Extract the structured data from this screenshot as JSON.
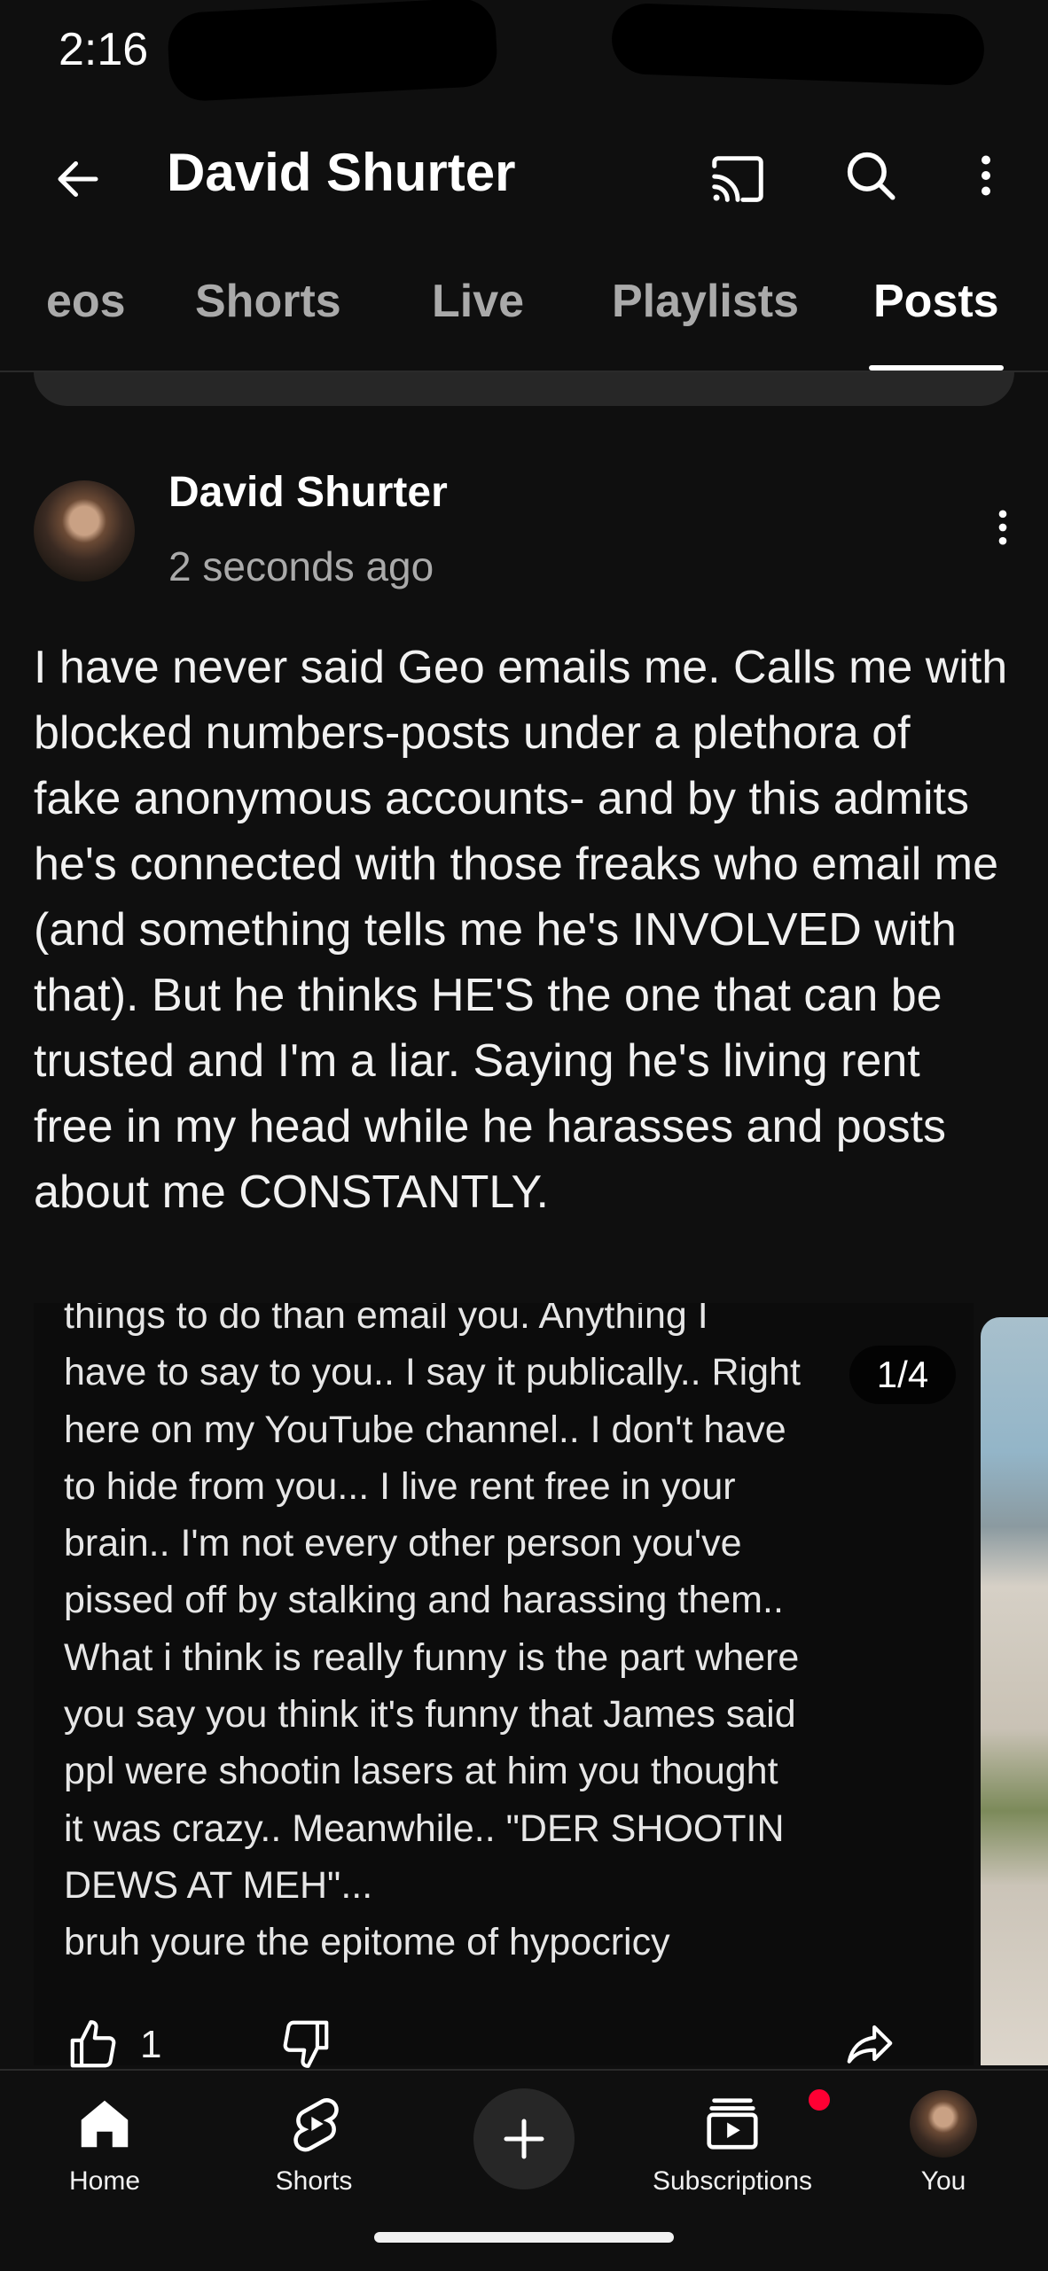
{
  "status_bar": {
    "time": "2:16"
  },
  "app_bar": {
    "title": "David Shurter"
  },
  "icons": {
    "back": "arrow-left-icon",
    "cast": "cast-icon",
    "search": "search-icon",
    "more": "more-vert-icon",
    "like": "thumbs-up-icon",
    "dislike": "thumbs-down-icon",
    "share": "share-icon",
    "home": "home-icon",
    "shorts": "shorts-icon",
    "create": "plus-icon",
    "subscriptions": "subscriptions-icon"
  },
  "tabs": [
    {
      "label": "eos",
      "active": false
    },
    {
      "label": "Shorts",
      "active": false
    },
    {
      "label": "Live",
      "active": false
    },
    {
      "label": "Playlists",
      "active": false
    },
    {
      "label": "Posts",
      "active": true
    }
  ],
  "post": {
    "author": "David Shurter",
    "time": "2 seconds ago",
    "text": "I have never said Geo emails me. Calls me with blocked numbers-posts under a plethora of fake anonymous accounts- and by this admits he's connected with those freaks who email me (and something tells me he's INVOLVED with that). But he thinks HE'S the one that can be trusted and I'm a liar. Saying he's living rent free in my head while he harasses and posts about me CONSTANTLY.",
    "image_counter": "1/4",
    "image_text_lines": [
      "things to do than email you. Anything I",
      "have to say to you.. I say it publically.. Right",
      "here on my YouTube channel.. I don't have",
      "to hide from you... I live rent free in your",
      "brain.. I'm not every other person you've",
      "pissed off by stalking and harassing them..",
      "What i think is really funny is the part where",
      "you say you think it's funny that James said",
      "ppl were shootin lasers at him  you thought",
      "it was crazy.. Meanwhile.. \"DER SHOOTIN",
      "DEWS AT MEH\"...",
      "bruh youre the epitome of hypocricy"
    ],
    "like_count": "1"
  },
  "bottom_nav": {
    "home": "Home",
    "shorts": "Shorts",
    "subscriptions": "Subscriptions",
    "you": "You"
  },
  "colors": {
    "background": "#0f0f0f",
    "text": "#f1f1f1",
    "secondary_text": "#aaaaaa",
    "notification": "#ff0033"
  }
}
